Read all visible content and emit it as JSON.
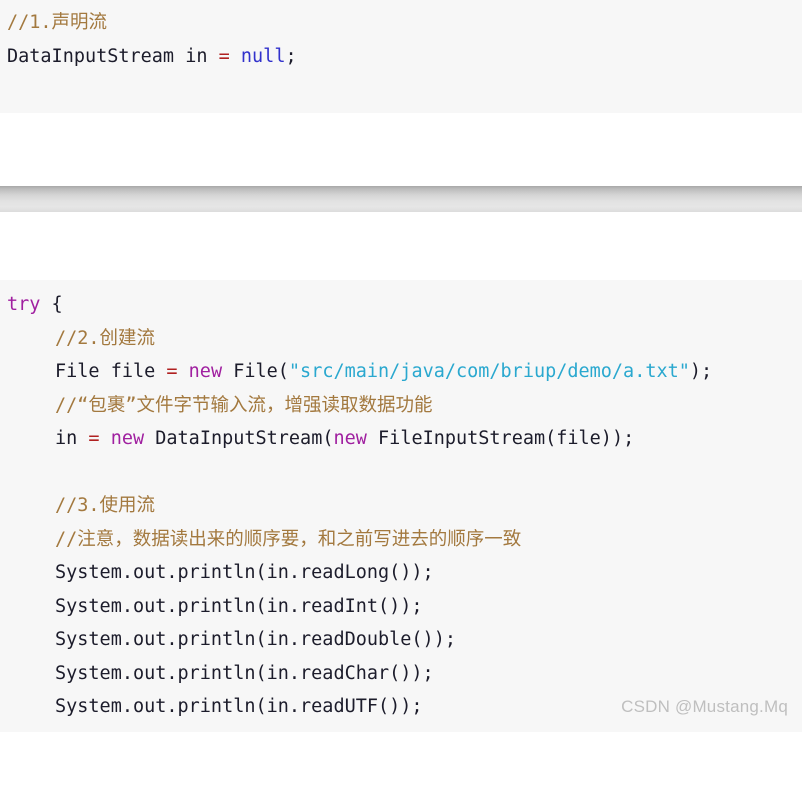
{
  "top_block": {
    "lines": [
      {
        "indent": 0,
        "tokens": [
          {
            "t": "//1.声明流",
            "c": "cmt"
          }
        ]
      },
      {
        "indent": 0,
        "tokens": [
          {
            "t": "DataInputStream in ",
            "c": "id"
          },
          {
            "t": "= ",
            "c": "op"
          },
          {
            "t": "null",
            "c": "nul"
          },
          {
            "t": ";",
            "c": "pun"
          }
        ]
      }
    ]
  },
  "main_block": {
    "lines": [
      {
        "indent": 0,
        "tokens": [
          {
            "t": "try",
            "c": "kw"
          },
          {
            "t": " {",
            "c": "pun"
          }
        ]
      },
      {
        "indent": 1,
        "tokens": [
          {
            "t": "//2.创建流",
            "c": "cmt"
          }
        ]
      },
      {
        "indent": 1,
        "tokens": [
          {
            "t": "File file ",
            "c": "id"
          },
          {
            "t": "= ",
            "c": "op"
          },
          {
            "t": "new",
            "c": "kw"
          },
          {
            "t": " File(",
            "c": "id"
          },
          {
            "t": "\"src/main/java/com/briup/demo/a.txt\"",
            "c": "str"
          },
          {
            "t": ");",
            "c": "pun"
          }
        ]
      },
      {
        "indent": 1,
        "tokens": [
          {
            "t": "//“包裹”文件字节输入流，增强读取数据功能",
            "c": "cmt"
          }
        ]
      },
      {
        "indent": 1,
        "tokens": [
          {
            "t": "in ",
            "c": "id"
          },
          {
            "t": "= ",
            "c": "op"
          },
          {
            "t": "new",
            "c": "kw"
          },
          {
            "t": " DataInputStream(",
            "c": "id"
          },
          {
            "t": "new",
            "c": "kw"
          },
          {
            "t": " FileInputStream(file));",
            "c": "id"
          }
        ]
      },
      {
        "indent": 1,
        "tokens": [
          {
            "t": " ",
            "c": "id"
          }
        ]
      },
      {
        "indent": 1,
        "tokens": [
          {
            "t": "//3.使用流",
            "c": "cmt"
          }
        ]
      },
      {
        "indent": 1,
        "tokens": [
          {
            "t": "//注意，数据读出来的顺序要，和之前写进去的顺序一致",
            "c": "cmt"
          }
        ]
      },
      {
        "indent": 1,
        "tokens": [
          {
            "t": "System.out.println(in.readLong());",
            "c": "id"
          }
        ]
      },
      {
        "indent": 1,
        "tokens": [
          {
            "t": "System.out.println(in.readInt());",
            "c": "id"
          }
        ]
      },
      {
        "indent": 1,
        "tokens": [
          {
            "t": "System.out.println(in.readDouble());",
            "c": "id"
          }
        ]
      },
      {
        "indent": 1,
        "tokens": [
          {
            "t": "System.out.println(in.readChar());",
            "c": "id"
          }
        ]
      },
      {
        "indent": 1,
        "tokens": [
          {
            "t": "System.out.println(in.readUTF());",
            "c": "id"
          }
        ]
      }
    ]
  },
  "watermark": {
    "text": "CSDN @Mustang.Mq",
    "color": "#bfbfbf"
  },
  "theme": {
    "code_background": "#f7f7f7",
    "page_background": "#ffffff",
    "comment_color": "#a3793f",
    "keyword_color": "#a020a0",
    "string_color": "#2aa8cf",
    "literal_color": "#3232cc",
    "operator_color": "#b02020",
    "identifier_color": "#1c1c2b"
  }
}
